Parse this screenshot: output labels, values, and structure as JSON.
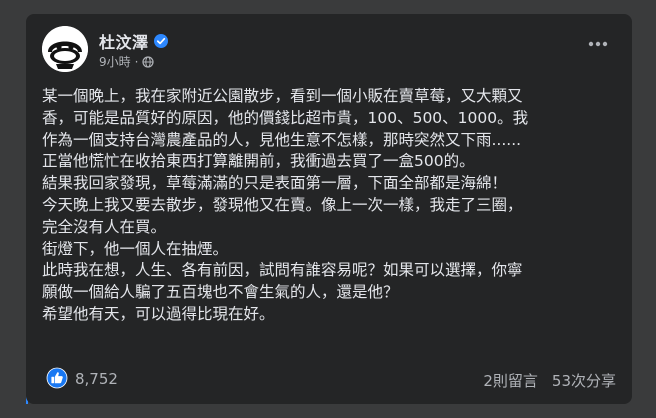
{
  "post": {
    "author": "杜汶澤",
    "time": "9小時",
    "separator": "·",
    "body_lines": [
      "某一個晚上，我在家附近公園散步，看到一個小販在賣草莓，又大顆又",
      "香，可能是品質好的原因，他的價錢比超市貴，100、500、1000。我",
      "作為一個支持台灣農產品的人，見他生意不怎樣，那時突然又下雨......",
      "正當他慌忙在收拾東西打算離開前，我衝過去買了一盒500的。",
      "結果我回家發現，草莓滿滿的只是表面第一層，下面全部都是海綿！",
      "今天晚上我又要去散步，發現他又在賣。像上一次一樣，我走了三圈，",
      "完全沒有人在買。",
      "街燈下，他一個人在抽煙。",
      "此時我在想，人生、各有前因，試問有誰容易呢？如果可以選擇，你寧",
      "願做一個給人騙了五百塊也不會生氣的人，還是他？",
      "希望他有天，可以過得比現在好。"
    ],
    "reactions_count": "8,752",
    "comments": "2則留言",
    "shares": "53次分享"
  },
  "icons": {
    "verified": "verified-badge-icon",
    "audience": "globe-icon",
    "more": "more-options-icon",
    "like": "like-reaction-icon"
  },
  "colors": {
    "card_bg": "#242526",
    "page_bg": "#3a3b3c",
    "text_primary": "#e4e6eb",
    "text_secondary": "#b0b3b8",
    "accent_blue": "#2d88ff"
  }
}
